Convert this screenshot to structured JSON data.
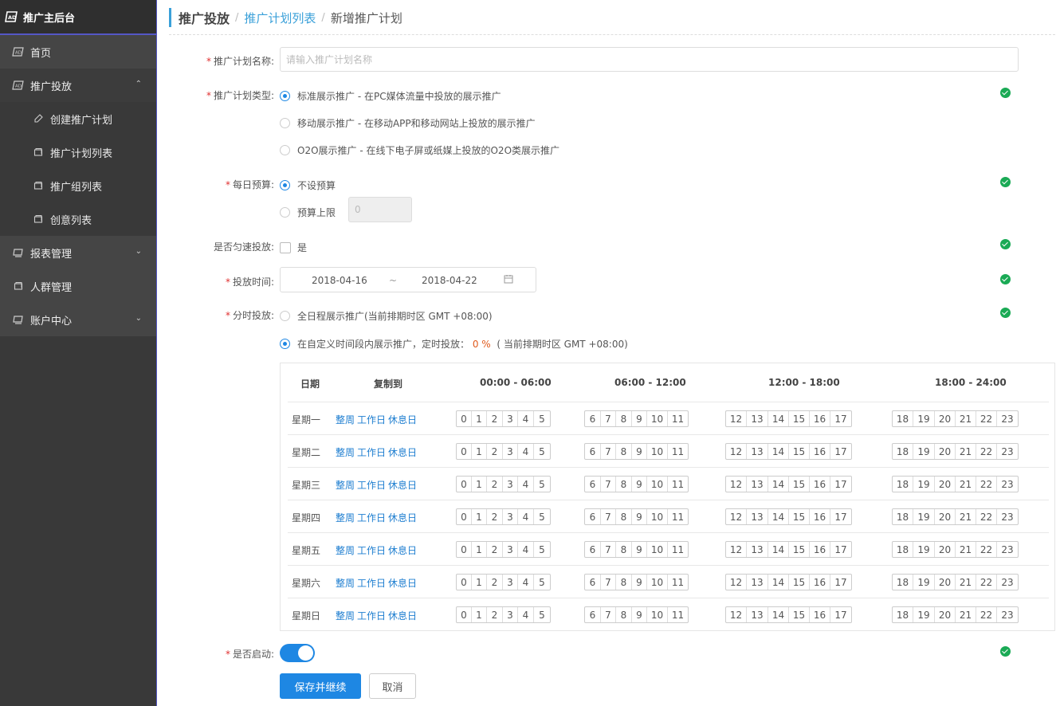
{
  "sidebar": {
    "title": "推广主后台",
    "items": [
      {
        "label": "首页",
        "icon": "ad-icon"
      },
      {
        "label": "推广投放",
        "icon": "ad-icon",
        "expanded": true
      },
      {
        "label": "报表管理",
        "icon": "report-icon"
      },
      {
        "label": "人群管理",
        "icon": "people-icon"
      },
      {
        "label": "账户中心",
        "icon": "account-icon"
      }
    ],
    "sub_items": [
      {
        "label": "创建推广计划",
        "icon": "pen-icon"
      },
      {
        "label": "推广计划列表",
        "icon": "list-icon"
      },
      {
        "label": "推广组列表",
        "icon": "list-icon"
      },
      {
        "label": "创意列表",
        "icon": "list-icon"
      }
    ]
  },
  "breadcrumb": {
    "root": "推广投放",
    "middle": "推广计划列表",
    "current": "新增推广计划",
    "sep": "/"
  },
  "form": {
    "name_label": "推广计划名称:",
    "name_placeholder": "请输入推广计划名称",
    "type_label": "推广计划类型:",
    "type_options": [
      "标准展示推广 - 在PC媒体流量中投放的展示推广",
      "移动展示推广 - 在移动APP和移动网站上投放的展示推广",
      "O2O展示推广 - 在线下电子屏或纸媒上投放的O2O类展示推广"
    ],
    "type_selected": 0,
    "budget_label": "每日预算:",
    "budget_options": [
      "不设预算",
      "预算上限"
    ],
    "budget_selected": 0,
    "budget_value": "0",
    "uniform_label": "是否匀速投放:",
    "uniform_option": "是",
    "uniform_checked": false,
    "time_label": "投放时间:",
    "date_start": "2018-04-16",
    "date_sep": "~",
    "date_end": "2018-04-22",
    "schedule_label": "分时投放:",
    "schedule_opt1": "全日程展示推广(当前排期时区 GMT +08:00)",
    "schedule_opt2_prefix": "在自定义时间段内展示推广，定时投放：",
    "schedule_opt2_pct": "0 %",
    "schedule_opt2_suffix": "( 当前排期时区 GMT +08:00)",
    "schedule_selected": 1,
    "enable_label": "是否启动:",
    "enabled": true,
    "save_label": "保存并继续",
    "cancel_label": "取消"
  },
  "schedule": {
    "headers": [
      "日期",
      "复制到",
      "00:00 - 06:00",
      "06:00 - 12:00",
      "12:00 - 18:00",
      "18:00 - 24:00"
    ],
    "days": [
      "星期一",
      "星期二",
      "星期三",
      "星期四",
      "星期五",
      "星期六",
      "星期日"
    ],
    "copy_links": [
      "整周",
      "工作日",
      "休息日"
    ],
    "hour_groups": [
      [
        "0",
        "1",
        "2",
        "3",
        "4",
        "5"
      ],
      [
        "6",
        "7",
        "8",
        "9",
        "10",
        "11"
      ],
      [
        "12",
        "13",
        "14",
        "15",
        "16",
        "17"
      ],
      [
        "18",
        "19",
        "20",
        "21",
        "22",
        "23"
      ]
    ]
  },
  "colors": {
    "accent": "#1e87e3",
    "ok": "#1aaa55",
    "required": "#e03030",
    "sidebar_bg": "#454545",
    "pct": "#e05a1c"
  }
}
